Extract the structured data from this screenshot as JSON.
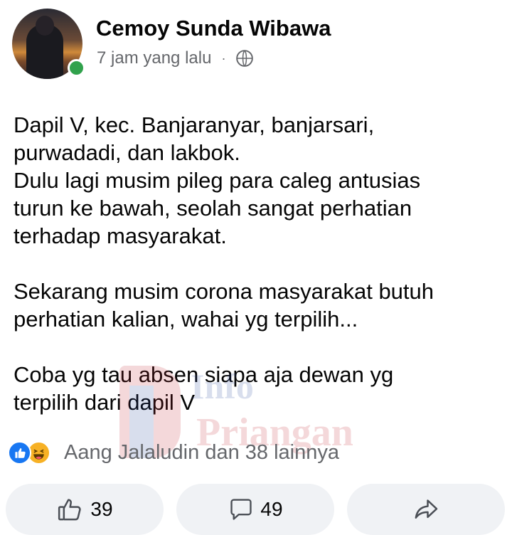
{
  "post": {
    "author": "Cemoy Sunda Wibawa",
    "timestamp": "7 jam yang lalu",
    "separator": "·",
    "privacy_icon": "globe-icon",
    "online": true,
    "paragraphs": [
      [
        "Dapil V, kec. Banjaranyar, banjarsari,",
        "purwadadi, dan lakbok.",
        "Dulu lagi musim pileg para caleg antusias",
        "turun ke bawah, seolah sangat perhatian",
        "terhadap masyarakat."
      ],
      [
        "Sekarang musim corona masyarakat butuh",
        "perhatian kalian, wahai yg terpilih..."
      ],
      [
        "Coba yg tau absen siapa aja dewan yg",
        "terpilih dari dapil V"
      ]
    ]
  },
  "watermark": {
    "line1": "Info",
    "line2": "Priangan"
  },
  "reactions": {
    "icons": [
      "like-reaction-icon",
      "haha-reaction-icon"
    ],
    "summary": "Aang Jalaludin dan 38 lainnya"
  },
  "actions": {
    "like_count": "39",
    "comment_count": "49",
    "share_icon": "share-arrow-icon"
  },
  "colors": {
    "online": "#31a24c",
    "like_blue": "#1877f2",
    "haha_yellow": "#f7b125",
    "secondary_text": "#65676b",
    "button_bg": "#f0f2f5"
  }
}
